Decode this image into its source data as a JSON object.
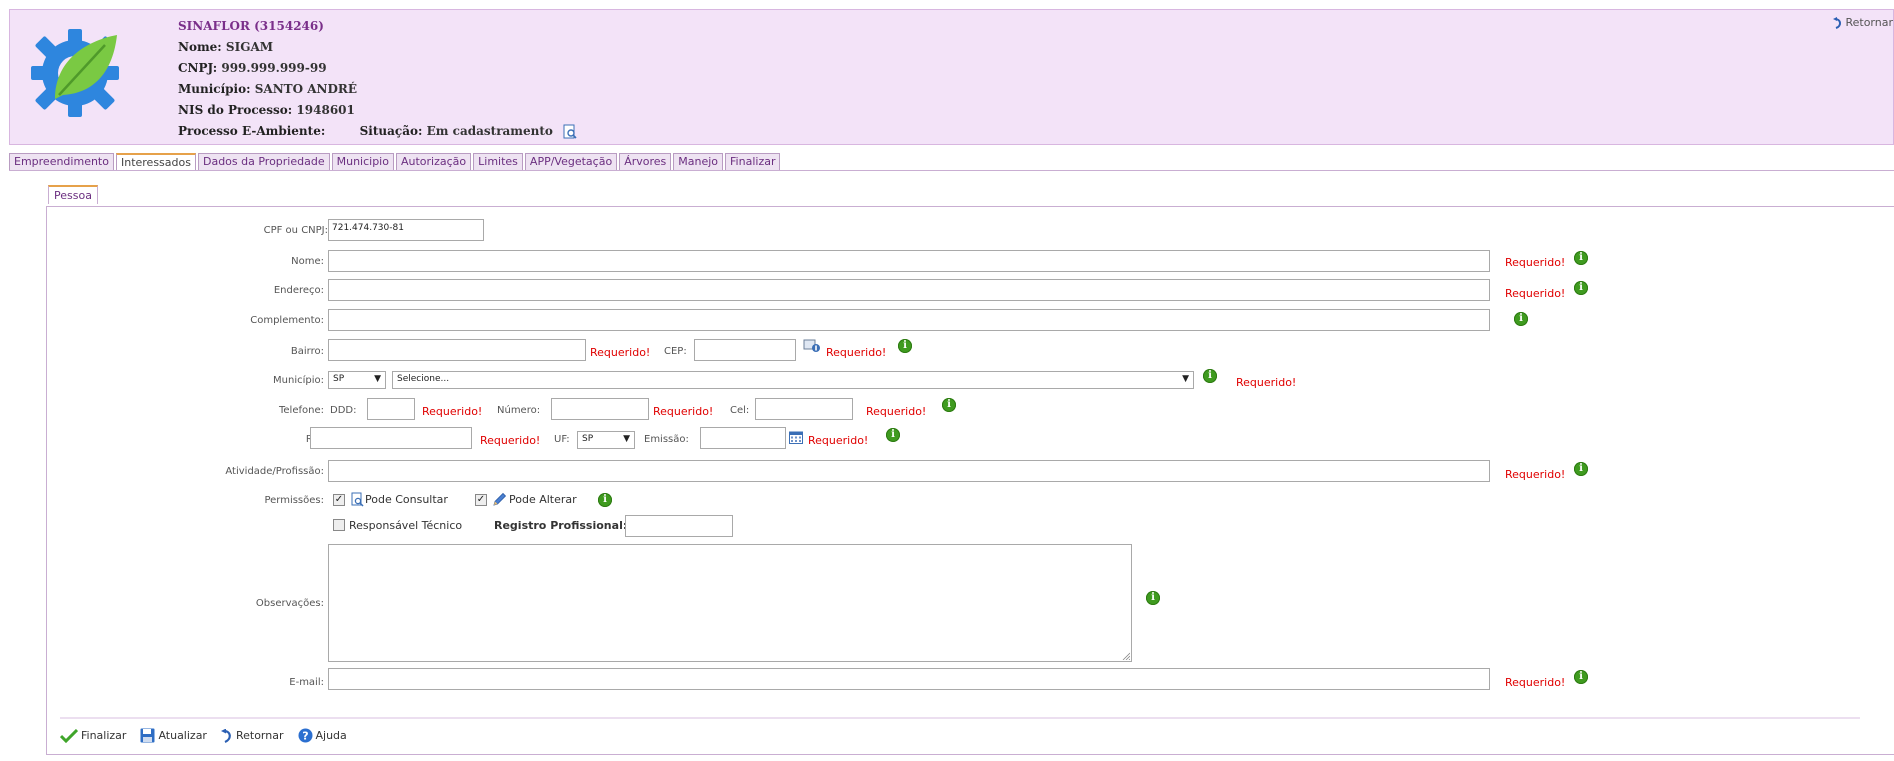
{
  "header": {
    "app": "SINAFLOR (3154246)",
    "nome_label": "Nome:",
    "nome": "SIGAM",
    "cnpj_label": "CNPJ:",
    "cnpj": "999.999.999-99",
    "municipio_label": "Município:",
    "municipio": "SANTO ANDRÉ",
    "nis_label": "NIS do Processo:",
    "nis": "1948601",
    "processo_label": "Processo E-Ambiente:",
    "situacao_label": "Situação:",
    "situacao": "Em cadastramento",
    "retornar": "Retornar"
  },
  "tabs": [
    "Empreendimento",
    "Interessados",
    "Dados da Propriedade",
    "Municipio",
    "Autorização",
    "Limites",
    "APP/Vegetação",
    "Árvores",
    "Manejo",
    "Finalizar"
  ],
  "active_tab": "Interessados",
  "subtab": "Pessoa",
  "form": {
    "cpf_label": "CPF ou CNPJ:",
    "cpf_value": "721.474.730-81",
    "nome_label": "Nome:",
    "endereco_label": "Endereço:",
    "complemento_label": "Complemento:",
    "bairro_label": "Bairro:",
    "cep_label": "CEP:",
    "municipio_label": "Município:",
    "uf_value": "SP",
    "municipio_value": "Selecione...",
    "telefone_label": "Telefone:",
    "ddd_label": "DDD:",
    "numero_label": "Número:",
    "cel_label": "Cel:",
    "rg_label": "RG:",
    "uf_label": "UF:",
    "rg_uf_value": "SP",
    "emissao_label": "Emissão:",
    "atividade_label": "Atividade/Profissão:",
    "permissoes_label": "Permissões:",
    "pode_consultar": "Pode Consultar",
    "pode_alterar": "Pode Alterar",
    "resp_tecnico": "Responsável Técnico",
    "registro_label": "Registro Profissional:",
    "observacoes_label": "Observações:",
    "email_label": "E-mail:",
    "required_text": "Requerido!",
    "info_glyph": "i"
  },
  "footer": {
    "finalizar": "Finalizar",
    "atualizar": "Atualizar",
    "retornar": "Retornar",
    "ajuda": "Ajuda"
  },
  "colors": {
    "header_bg": "#f3e3f8",
    "required": "#e00000",
    "info": "#3f9b1f",
    "tab_accent": "#e6a14a"
  }
}
